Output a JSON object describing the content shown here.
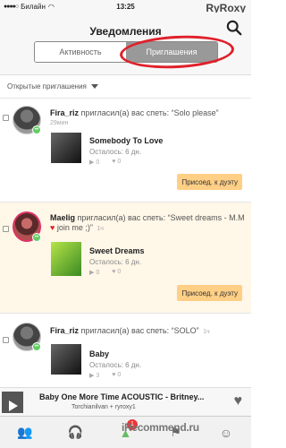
{
  "status_bar": {
    "carrier": "Билайн",
    "time": "13:25",
    "watermark": "RyRoxy"
  },
  "header": {
    "title": "Уведомления"
  },
  "tabs": [
    {
      "label": "Активность",
      "active": false
    },
    {
      "label": "Приглашения",
      "active": true
    }
  ],
  "filter": {
    "label": "Открытые приглашения"
  },
  "cards": [
    {
      "user": "Fira_riz",
      "message": " пригласил(а) вас спеть: “Solo please”",
      "time": "29мин",
      "song": "Somebody To Love",
      "remaining": "Осталось: 6 дн.",
      "plays": "0",
      "likes": "0",
      "button": "Присоед. к дуэту"
    },
    {
      "user": "Maelig",
      "message": " пригласил(а) вас спеть: “Sweet dreams - M.M",
      "message_after_heart": " join me ;)”",
      "time": "1ч",
      "song": "Sweet Dreams",
      "remaining": "Осталось: 6 дн.",
      "plays": "0",
      "likes": "0",
      "button": "Присоед. к дуэту"
    },
    {
      "user": "Fira_riz",
      "message": " пригласил(а) вас спеть: “SOLO”",
      "time": "1ч",
      "song": "Baby",
      "remaining": "Осталось: 6 дн.",
      "plays": "3",
      "likes": "0"
    }
  ],
  "player": {
    "title": "Baby One More Time ACOUSTIC - Britney...",
    "artists": "Torchianilvan + ryroxy1"
  },
  "watermark_logo": {
    "brand": "iRecommend",
    "suffix": ".ru",
    "badge": "1"
  },
  "accent_colors": {
    "join_button": "#ffcf86",
    "annotation_circle": "#e0202a",
    "active_tab": "#999999"
  }
}
